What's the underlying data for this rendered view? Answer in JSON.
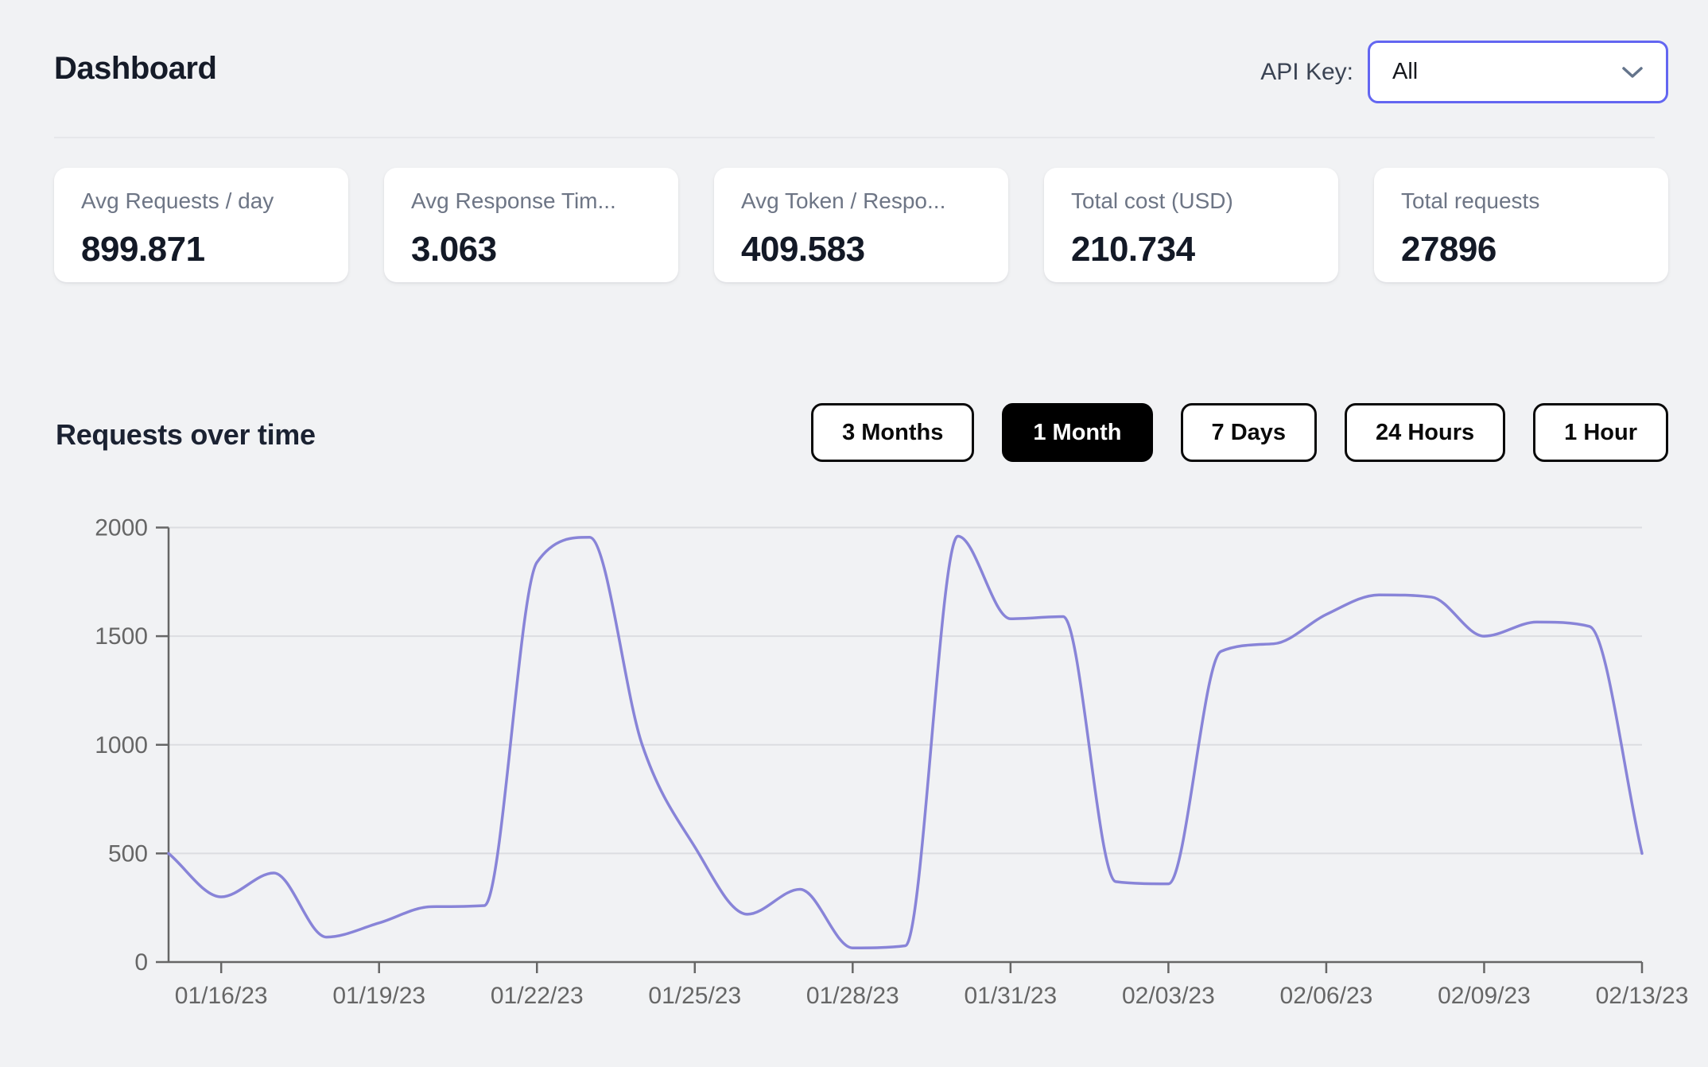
{
  "header": {
    "title": "Dashboard",
    "api_key_label": "API Key:",
    "api_key_value": "All"
  },
  "stats": [
    {
      "label": "Avg Requests / day",
      "value": "899.871"
    },
    {
      "label": "Avg Response Tim...",
      "value": "3.063"
    },
    {
      "label": "Avg Token / Respo...",
      "value": "409.583"
    },
    {
      "label": "Total cost (USD)",
      "value": "210.734"
    },
    {
      "label": "Total requests",
      "value": "27896"
    }
  ],
  "section": {
    "title": "Requests over time",
    "range_buttons": [
      {
        "label": "3 Months",
        "active": false
      },
      {
        "label": "1 Month",
        "active": true
      },
      {
        "label": "7 Days",
        "active": false
      },
      {
        "label": "24 Hours",
        "active": false
      },
      {
        "label": "1 Hour",
        "active": false
      }
    ]
  },
  "chart_data": {
    "type": "line",
    "title": "Requests over time",
    "x_tick_labels": [
      "01/16/23",
      "01/19/23",
      "01/22/23",
      "01/25/23",
      "01/28/23",
      "01/31/23",
      "02/03/23",
      "02/06/23",
      "02/09/23",
      "02/13/23"
    ],
    "x_tick_indices": [
      1,
      4,
      7,
      10,
      13,
      16,
      19,
      22,
      25,
      28
    ],
    "values": [
      500,
      300,
      410,
      115,
      180,
      255,
      260,
      1840,
      1955,
      1000,
      530,
      220,
      335,
      65,
      75,
      1960,
      1580,
      1590,
      370,
      360,
      1430,
      1465,
      1600,
      1690,
      1680,
      1500,
      1565,
      1545,
      500
    ],
    "ylim": [
      0,
      2000
    ],
    "yticks": [
      0,
      500,
      1000,
      1500,
      2000
    ],
    "grid": true,
    "legend": false,
    "line_color": "#8884d8",
    "axis_color": "#666666",
    "grid_color": "#dcdde1"
  },
  "colors": {
    "accent": "#6366f1",
    "active_button_bg": "#000000",
    "page_background": "#f1f2f4",
    "card_background": "#ffffff"
  }
}
